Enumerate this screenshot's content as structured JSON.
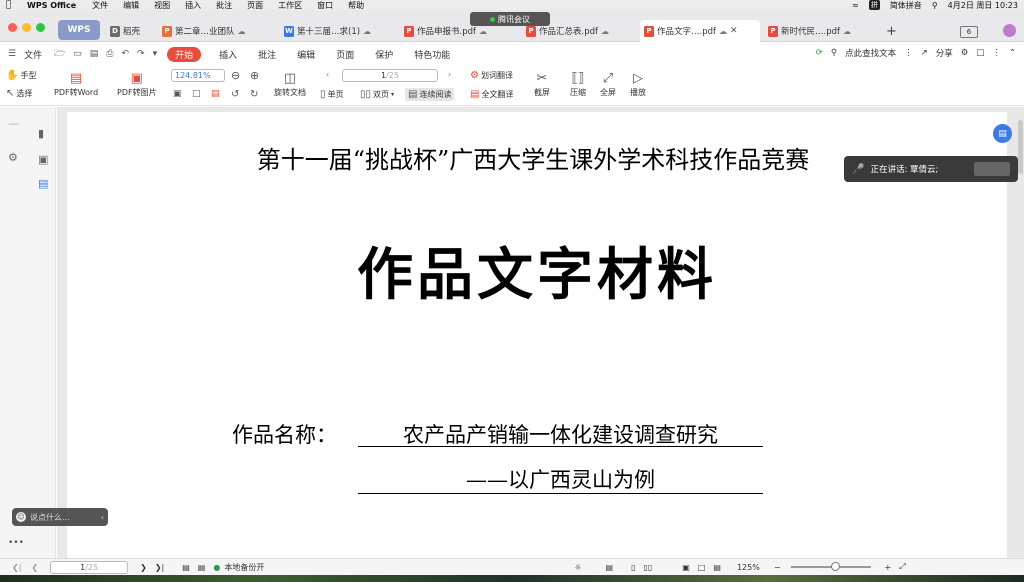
{
  "menubar": {
    "app_name": "WPS Office",
    "menus": [
      "文件",
      "编辑",
      "视图",
      "插入",
      "批注",
      "页面",
      "工作区",
      "窗口",
      "帮助"
    ],
    "input_method": "拼",
    "input_method_label": "简体拼音",
    "datetime": "4月2日 周日 10:23"
  },
  "meeting_badge": "腾讯会议",
  "tabs": {
    "home_label": "WPS",
    "items": [
      {
        "label": "稻壳",
        "icon": "daoke-icon",
        "color": "#6b6b6b"
      },
      {
        "label": "第二章…业团队",
        "icon": "ppt-file-icon",
        "color": "#e8703a"
      },
      {
        "label": "第十三届…求(1)",
        "icon": "word-file-icon",
        "color": "#3b7be8"
      },
      {
        "label": "作品申报书.pdf",
        "icon": "pdf-file-icon",
        "color": "#e94c3d"
      },
      {
        "label": "作品汇总表.pdf",
        "icon": "pdf-file-icon",
        "color": "#e94c3d"
      },
      {
        "label": "作品文字….pdf",
        "icon": "pdf-file-icon",
        "color": "#e94c3d",
        "active": true
      },
      {
        "label": "新时代民….pdf",
        "icon": "pdf-file-icon",
        "color": "#e94c3d"
      }
    ],
    "page_indicator": "6"
  },
  "ribbon": {
    "file_label": "文件",
    "tabs": [
      "开始",
      "插入",
      "批注",
      "编辑",
      "页面",
      "保护",
      "特色功能"
    ],
    "active_tab": "开始",
    "search_label": "点此查找文本",
    "share_label": "分享"
  },
  "toolbar": {
    "hand_label": "手型",
    "select_label": "选择",
    "pdf_to_word": "PDF转Word",
    "pdf_to_image": "PDF转图片",
    "zoom_value": "124.81%",
    "rotate_label": "旋转文档",
    "page_current": "1",
    "page_total": "/25",
    "single_page": "单页",
    "double_page": "双页",
    "continuous": "连续阅读",
    "word_translate": "划词翻译",
    "full_translate": "全文翻译",
    "screenshot": "截屏",
    "compress": "压缩",
    "fullscreen": "全屏",
    "play": "播放"
  },
  "document": {
    "competition_title": "第十一届“挑战杯”广西大学生课外学术科技作品竞赛",
    "doc_title": "作品文字材料",
    "name_label": "作品名称：",
    "name_value": "农产品产销输一体化建设调查研究",
    "name_subtitle": "——以广西灵山为例"
  },
  "speaking_banner": "正在讲话: 覃倩云;",
  "chat_placeholder": "说点什么...",
  "statusbar": {
    "page_current": "1",
    "page_total": "/25",
    "backup_label": "本地备份开",
    "zoom": "125%"
  }
}
